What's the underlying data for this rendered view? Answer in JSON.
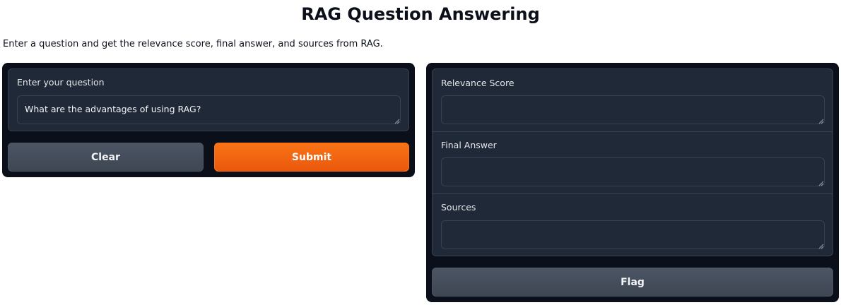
{
  "page": {
    "title": "RAG Question Answering",
    "description": "Enter a question and get the relevance score, final answer, and sources from RAG."
  },
  "input": {
    "label": "Enter your question",
    "value": "What are the advantages of using RAG?"
  },
  "buttons": {
    "clear": "Clear",
    "submit": "Submit",
    "flag": "Flag"
  },
  "outputs": {
    "relevance": {
      "label": "Relevance Score",
      "value": ""
    },
    "answer": {
      "label": "Final Answer",
      "value": ""
    },
    "sources": {
      "label": "Sources",
      "value": ""
    }
  },
  "colors": {
    "panel_bg": "#0b0f19",
    "block_bg": "#1f2937",
    "border": "#374151",
    "primary": "#f97316",
    "secondary": "#4b5563"
  }
}
